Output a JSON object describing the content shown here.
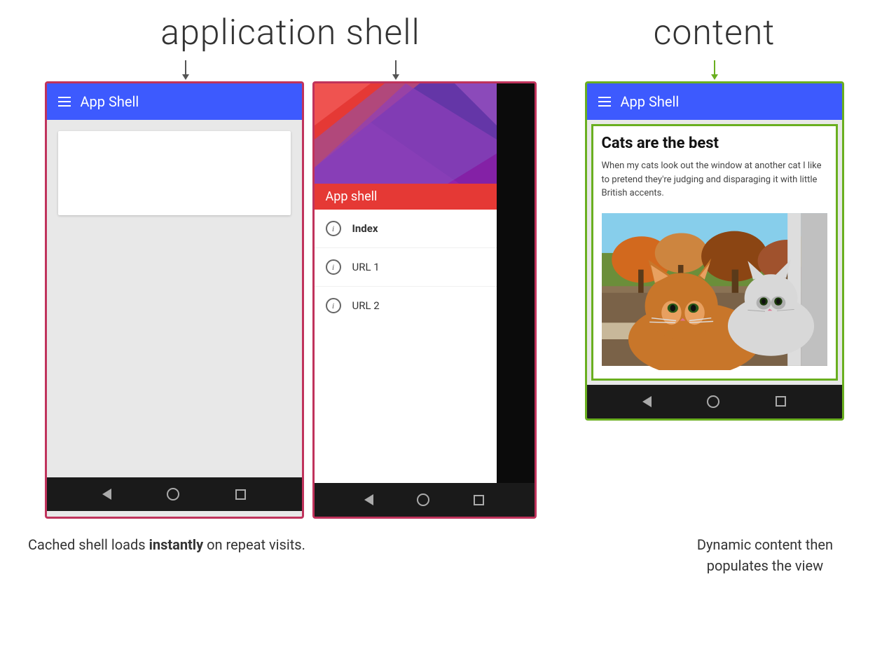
{
  "labels": {
    "app_shell_label": "application shell",
    "content_label": "content"
  },
  "phone1": {
    "app_bar_title": "App Shell"
  },
  "phone2": {
    "app_shell_banner": "App shell",
    "menu_items": [
      {
        "label": "Index",
        "active": true
      },
      {
        "label": "URL 1",
        "active": false
      },
      {
        "label": "URL 2",
        "active": false
      }
    ]
  },
  "phone3": {
    "app_bar_title": "App Shell",
    "content_title": "Cats are the best",
    "content_text": "When my cats look out the window at another cat I like to pretend they're judging and disparaging it with little British accents."
  },
  "nav": {
    "back_label": "◁",
    "home_label": "○",
    "recents_label": "□"
  },
  "captions": {
    "left": [
      "Cached shell loads ",
      "instantly",
      " on repeat visits."
    ],
    "right_line1": "Dynamic content then",
    "right_line2": "populates the view"
  }
}
